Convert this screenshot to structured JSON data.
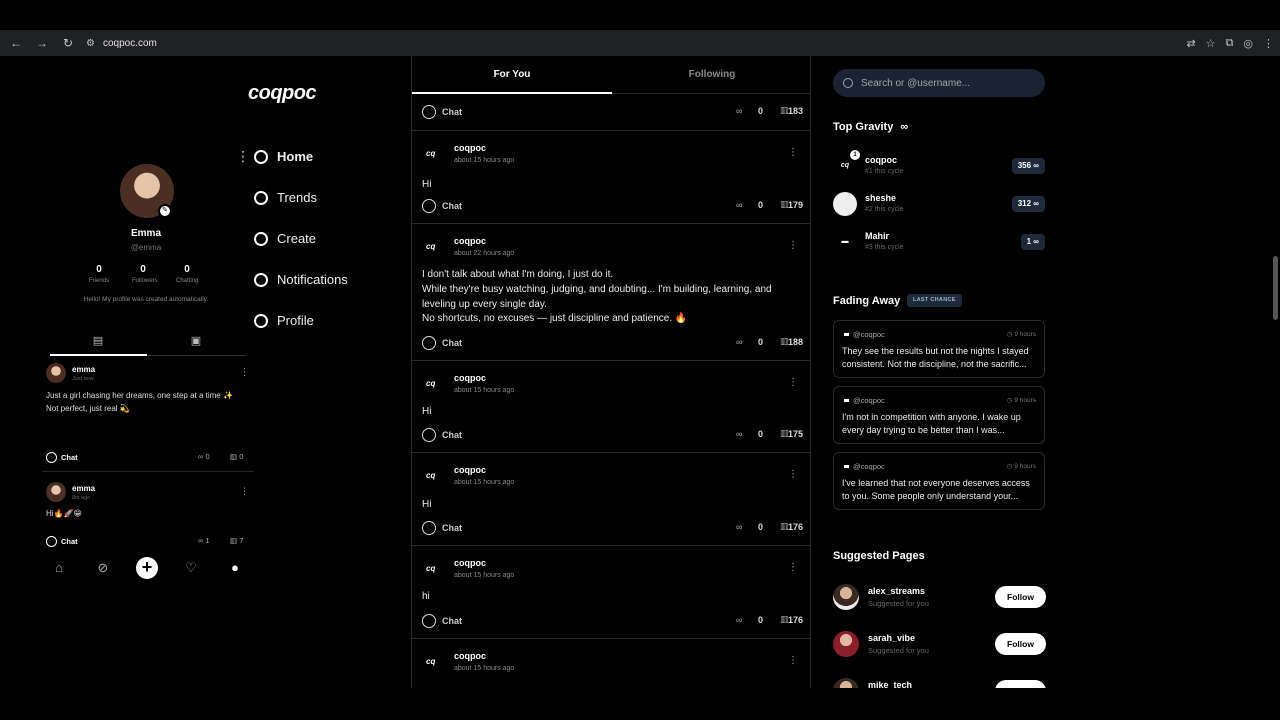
{
  "browser": {
    "url": "coqpoc.com"
  },
  "brand": {
    "logo": "coqpoc"
  },
  "nav": {
    "items": [
      {
        "label": "Home",
        "active": true
      },
      {
        "label": "Trends"
      },
      {
        "label": "Create"
      },
      {
        "label": "Notifications"
      },
      {
        "label": "Profile"
      }
    ]
  },
  "profile": {
    "name": "Emma",
    "handle": "@emma",
    "stats": [
      {
        "value": "0",
        "label": "Friends"
      },
      {
        "value": "0",
        "label": "Followers"
      },
      {
        "value": "0",
        "label": "Chatting"
      }
    ],
    "bio": "Hello! My profile was created automatically.",
    "posts": [
      {
        "name": "emma",
        "time": "Just now",
        "text": "Just a girl chasing her dreams, one step at a time ✨\nNot perfect, just real 💫",
        "chat": "Chat",
        "gravity": "0",
        "views": "0"
      },
      {
        "name": "emma",
        "time": "8m ago",
        "text": "Hi🔥🚀😁",
        "chat": "Chat",
        "gravity": "1",
        "views": "7"
      }
    ]
  },
  "feed": {
    "tabs": [
      "For You",
      "Following"
    ],
    "top_partial": {
      "chat": "Chat",
      "gravity": "0",
      "views": "183"
    },
    "posts": [
      {
        "author": "coqpoc",
        "time": "about 15 hours ago",
        "text": "Hi",
        "chat": "Chat",
        "gravity": "0",
        "views": "179"
      },
      {
        "author": "coqpoc",
        "time": "about 22 hours ago",
        "text": "I don't talk about what I'm doing, I just do it.\nWhile they're busy watching, judging, and doubting... I'm building, learning, and leveling up every single day.\nNo shortcuts, no excuses — just discipline and patience. 🔥",
        "chat": "Chat",
        "gravity": "0",
        "views": "188"
      },
      {
        "author": "coqpoc",
        "time": "about 15 hours ago",
        "text": "Hi",
        "chat": "Chat",
        "gravity": "0",
        "views": "175"
      },
      {
        "author": "coqpoc",
        "time": "about 15 hours ago",
        "text": "Hi",
        "chat": "Chat",
        "gravity": "0",
        "views": "176"
      },
      {
        "author": "coqpoc",
        "time": "about 15 hours ago",
        "text": "hi",
        "chat": "Chat",
        "gravity": "0",
        "views": "176"
      },
      {
        "author": "coqpoc",
        "time": "about 15 hours ago"
      }
    ]
  },
  "search": {
    "placeholder": "Search or @username..."
  },
  "top_gravity": {
    "title": "Top Gravity",
    "icon": "∞",
    "rows": [
      {
        "name": "coqpoc",
        "sub": "#1 this cycle",
        "score": "356 ∞",
        "badge": "1"
      },
      {
        "name": "sheshe",
        "sub": "#2 this cycle",
        "score": "312 ∞"
      },
      {
        "name": "Mahir",
        "sub": "#3 this cycle",
        "score": "1 ∞"
      }
    ]
  },
  "fading": {
    "title": "Fading Away",
    "badge": "LAST CHANCE",
    "cards": [
      {
        "handle": "@coqpoc",
        "time": "9 hours",
        "text": "They see the results but not the nights I stayed consistent. Not the discipline, not the sacrific..."
      },
      {
        "handle": "@coqpoc",
        "time": "9 hours",
        "text": "I'm not in competition with anyone. I wake up every day trying to be better than I was..."
      },
      {
        "handle": "@coqpoc",
        "time": "9 hours",
        "text": "I've learned that not everyone deserves access to you. Some people only understand your..."
      }
    ]
  },
  "suggested": {
    "title": "Suggested Pages",
    "follow_label": "Follow",
    "rows": [
      {
        "name": "alex_streams",
        "sub": "Suggested for you"
      },
      {
        "name": "sarah_vibe",
        "sub": "Suggested for you"
      },
      {
        "name": "mike_tech"
      }
    ]
  }
}
